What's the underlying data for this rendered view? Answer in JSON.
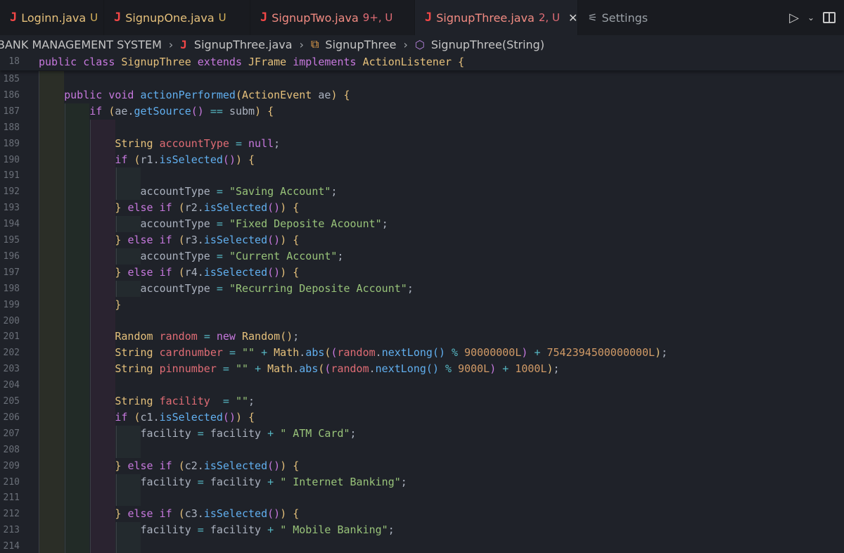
{
  "tabs": [
    {
      "name": "Loginn.java",
      "status": "U"
    },
    {
      "name": "SignupOne.java",
      "status": "U"
    },
    {
      "name": "SignupTwo.java",
      "status": "9+, U"
    },
    {
      "name": "SignupThree.java",
      "status": "2, U",
      "active": true
    },
    {
      "name": "Settings"
    }
  ],
  "breadcrumb": {
    "root": "BANK MANAGEMENT SYSTEM",
    "file": "SignupThree.java",
    "class": "SignupThree",
    "method": "SignupThree(String)"
  },
  "sticky": {
    "line": "18",
    "text": "public class SignupThree extends JFrame implements ActionListener {"
  },
  "line_numbers": [
    "185",
    "186",
    "187",
    "188",
    "189",
    "190",
    "191",
    "192",
    "193",
    "194",
    "195",
    "196",
    "197",
    "198",
    "199",
    "200",
    "201",
    "202",
    "203",
    "204",
    "205",
    "206",
    "207",
    "208",
    "209",
    "210",
    "211",
    "212",
    "213",
    "214"
  ],
  "code_lines": [
    "",
    "    public void actionPerformed(ActionEvent ae) {",
    "        if (ae.getSource() == subm) {",
    "",
    "            String accountType = null;",
    "            if (r1.isSelected()) {",
    "",
    "                accountType = \"Saving Account\";",
    "            } else if (r2.isSelected()) {",
    "                accountType = \"Fixed Deposite Acoount\";",
    "            } else if (r3.isSelected()) {",
    "                accountType = \"Current Account\";",
    "            } else if (r4.isSelected()) {",
    "                accountType = \"Recurring Deposite Account\";",
    "            }",
    "",
    "            Random random = new Random();",
    "            String cardnumber = \"\" + Math.abs((random.nextLong() % 90000000L) + 7542394500000000L);",
    "            String pinnumber = \"\" + Math.abs((random.nextLong() % 9000L) + 1000L);",
    "",
    "            String facility  = \"\";",
    "            if (c1.isSelected()) {",
    "                facility = facility + \" ATM Card\";",
    "",
    "            } else if (c2.isSelected()) {",
    "                facility = facility + \" Internet Banking\";",
    "",
    "            } else if (c3.isSelected()) {",
    "                facility = facility + \" Mobile Banking\";",
    ""
  ],
  "colors": {
    "keyword": "#c678dd",
    "type": "#e5c07b",
    "function": "#61afef",
    "string": "#98c379",
    "number": "#d19a66",
    "variable": "#e06c75",
    "java_icon": "#f44747"
  },
  "icons": {
    "java": "J",
    "settings": "settings-sliders-icon",
    "run": "play-icon",
    "split": "split-editor-icon",
    "class": "class-icon",
    "method": "method-cube-icon"
  }
}
